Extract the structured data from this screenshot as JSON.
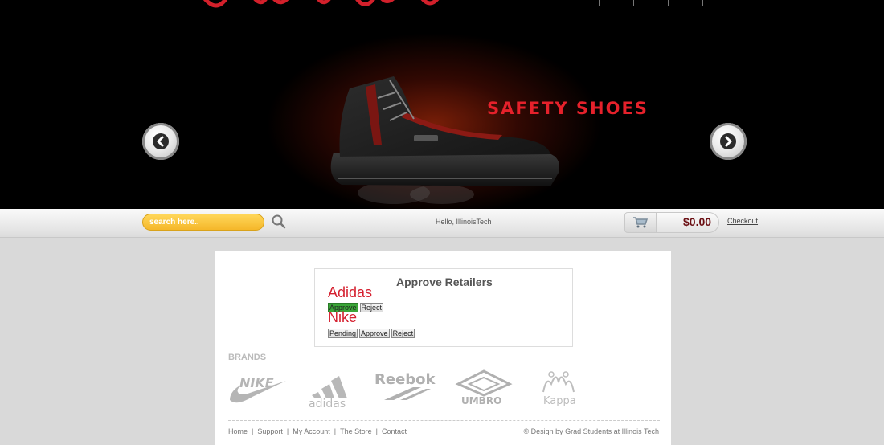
{
  "hero": {
    "title": "SAFETY SHOES",
    "prev_icon": "chevron-left-icon",
    "next_icon": "chevron-right-icon",
    "accent_color": "#e5212b"
  },
  "toolbar": {
    "search_placeholder": "search here..",
    "search_icon": "search-icon",
    "greeting": "Hello, IllinoisTech",
    "cart_icon": "cart-icon",
    "cart_total": "$0.00",
    "checkout_label": "Checkout"
  },
  "approve": {
    "title": "Approve Retailers",
    "retailers": [
      {
        "name": "Adidas",
        "buttons": [
          "Approve",
          "Reject"
        ],
        "active": "Approve"
      },
      {
        "name": "Nike",
        "buttons": [
          "Pending",
          "Approve",
          "Reject"
        ],
        "active": ""
      }
    ]
  },
  "brands": {
    "heading": "BRANDS",
    "logos": [
      "Nike",
      "adidas",
      "Reebok",
      "UMBRO",
      "Kappa"
    ]
  },
  "footer": {
    "links": [
      "Home",
      "Support",
      "My Account",
      "The Store",
      "Contact"
    ],
    "separator": "|",
    "credit": "© Design by Grad Students at Illinois Tech"
  }
}
